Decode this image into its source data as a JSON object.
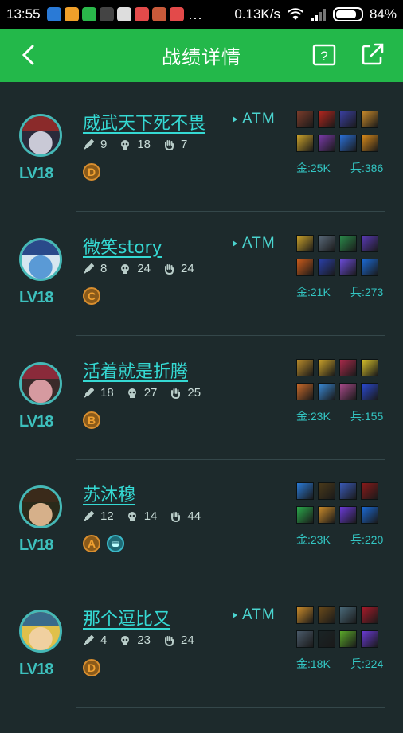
{
  "status_bar": {
    "time": "13:55",
    "speed": "0.13K/s",
    "battery": "84%",
    "battery_level": 0.84,
    "dots": "..."
  },
  "header": {
    "title": "战绩详情"
  },
  "colors": {
    "header_green": "#23b84a",
    "background": "#1d2a2c",
    "accent_cyan": "#35d9d3"
  },
  "players": [
    {
      "name": "威武天下死不畏",
      "level": "LV18",
      "atm": "ATM",
      "kills": "9",
      "deaths": "18",
      "assists": "7",
      "grade": "D",
      "mvp": false,
      "gold": "金:25K",
      "minions": "兵:386",
      "items": [
        "#7a3b2a",
        "#b3261e",
        "#3a3fa0",
        "#c98a2a",
        "#c9a02a",
        "#7a3aa8",
        "#2a6fd6",
        "#d98a1a"
      ]
    },
    {
      "name": "微笑story",
      "level": "LV18",
      "atm": "ATM",
      "kills": "8",
      "deaths": "24",
      "assists": "24",
      "grade": "C",
      "mvp": false,
      "gold": "金:21K",
      "minions": "兵:273",
      "items": [
        "#c9a02a",
        "#5a6a7a",
        "#2a8a4a",
        "#5a3ab8",
        "#c95a1a",
        "#2a3fa8",
        "#6a4ad6",
        "#1a6ad6"
      ]
    },
    {
      "name": "活着就是折腾",
      "level": "LV18",
      "atm": "",
      "kills": "18",
      "deaths": "27",
      "assists": "25",
      "grade": "B",
      "mvp": false,
      "gold": "金:23K",
      "minions": "兵:155",
      "items": [
        "#b88a2a",
        "#c9a02a",
        "#a82a4a",
        "#d6c02a",
        "#c96a2a",
        "#3a8ad6",
        "#a84a8a",
        "#2a4ad6"
      ]
    },
    {
      "name": "苏沐穆",
      "level": "LV18",
      "atm": "",
      "kills": "12",
      "deaths": "14",
      "assists": "44",
      "grade": "A",
      "mvp": true,
      "gold": "金:23K",
      "minions": "兵:220",
      "items": [
        "#2a7ad6",
        "#4a3a1a",
        "#3a5ab8",
        "#8a1a1a",
        "#2aa84a",
        "#c98a2a",
        "#6a3ad6",
        "#1a6ad6"
      ]
    },
    {
      "name": "那个逗比又",
      "level": "LV18",
      "atm": "ATM",
      "kills": "4",
      "deaths": "23",
      "assists": "24",
      "grade": "D",
      "mvp": false,
      "gold": "金:18K",
      "minions": "兵:224",
      "items": [
        "#c98a2a",
        "#6a4a1a",
        "#4a6a7a",
        "#a81a2a",
        "#4a5a6a",
        "#1a2426",
        "#5aa82a",
        "#6a3ad6"
      ]
    }
  ]
}
